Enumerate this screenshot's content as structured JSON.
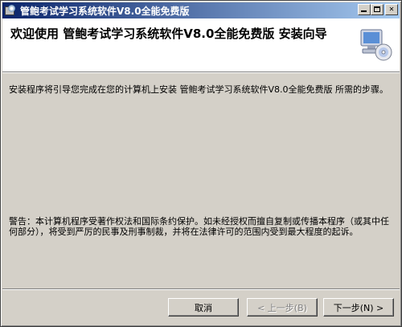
{
  "window": {
    "title": "管鲍考试学习系统软件V8.0全能免费版",
    "icon": "installer-icon"
  },
  "titlebar_buttons": {
    "minimize_icon": "minimize-icon",
    "maximize_icon": "maximize-icon",
    "close_glyph": "✕"
  },
  "header": {
    "title": "欢迎使用 管鲍考试学习系统软件V8.0全能免费版 安装向导",
    "icon": "computer-cd-icon"
  },
  "body": {
    "intro": "安装程序将引导您完成在您的计算机上安装 管鲍考试学习系统软件V8.0全能免费版 所需的步骤。",
    "warning": "警告：本计算机程序受著作权法和国际条约保护。如未经授权而擅自复制或传播本程序（或其中任何部分），将受到严厉的民事及刑事制裁，并将在法律许可的范围内受到最大程度的起诉。"
  },
  "buttons": {
    "cancel": "取消",
    "back": "< 上一步(B)",
    "next": "下一步(N) >"
  },
  "colors": {
    "titlebar_start": "#0a246a",
    "titlebar_end": "#a6caf0",
    "face": "#d4d0c8",
    "disabled_text": "#808080"
  }
}
